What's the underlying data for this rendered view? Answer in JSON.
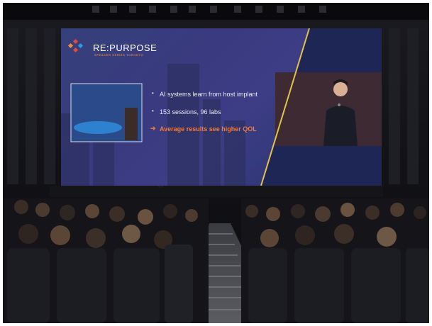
{
  "slide": {
    "brand": "RE:PURPOSE",
    "brand_subtitle": "SPEAKER SERIES TORONTO",
    "bullets": [
      "AI systems learn from host implant",
      "153 sessions, 96 labs",
      "Average results see higher QOL"
    ]
  },
  "colors": {
    "accent": "#f07a3a",
    "screen_bg": "#3a3a80",
    "hall_dark": "#0e0e12"
  }
}
